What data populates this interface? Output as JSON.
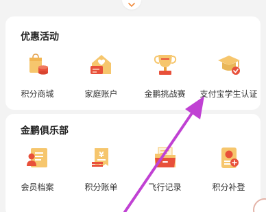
{
  "colors": {
    "accent_orange": "#f08a3c",
    "accent_red": "#e8503a",
    "annotation_arrow": "#c041d3"
  },
  "sections": [
    {
      "title": "优惠活动",
      "items": [
        {
          "label": "积分商城",
          "icon": "shopping-bag-coins-icon"
        },
        {
          "label": "家庭账户",
          "icon": "family-house-icon"
        },
        {
          "label": "金鹏挑战赛",
          "icon": "trophy-icon"
        },
        {
          "label": "支付宝学生认证",
          "icon": "graduation-cap-icon"
        }
      ]
    },
    {
      "title": "金鹏俱乐部",
      "items": [
        {
          "label": "会员档案",
          "icon": "member-profile-icon"
        },
        {
          "label": "积分账单",
          "icon": "points-bill-icon"
        },
        {
          "label": "飞行记录",
          "icon": "flight-record-folder-icon"
        },
        {
          "label": "积分补登",
          "icon": "points-supplement-icon"
        }
      ]
    }
  ]
}
